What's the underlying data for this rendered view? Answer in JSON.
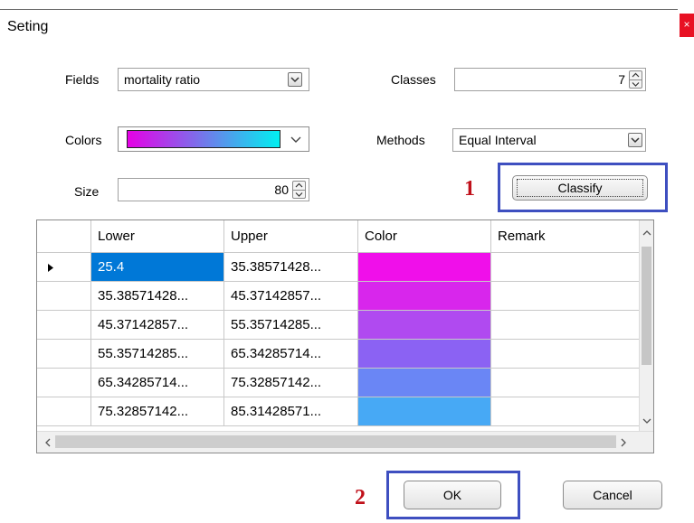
{
  "window": {
    "title": "Seting",
    "close_glyph": "×"
  },
  "form": {
    "fields_label": "Fields",
    "fields_value": "mortality ratio",
    "classes_label": "Classes",
    "classes_value": "7",
    "colors_label": "Colors",
    "color_ramp": [
      "#e600e6",
      "#00f0f0"
    ],
    "methods_label": "Methods",
    "methods_value": "Equal Interval",
    "size_label": "Size",
    "size_value": "80"
  },
  "classify_button": "Classify",
  "annotations": {
    "marker_1": "1",
    "marker_2": "2",
    "highlight_color": "#3e4fc0",
    "marker_color": "#c0101a"
  },
  "table": {
    "columns": [
      "Lower",
      "Upper",
      "Color",
      "Remark"
    ],
    "rows": [
      {
        "lower": "25.4",
        "upper": "35.38571428...",
        "color": "#f00fea",
        "remark": ""
      },
      {
        "lower": "35.38571428...",
        "upper": "45.37142857...",
        "color": "#d826ec",
        "remark": ""
      },
      {
        "lower": "45.37142857...",
        "upper": "55.35714285...",
        "color": "#b04af0",
        "remark": ""
      },
      {
        "lower": "55.35714285...",
        "upper": "65.34285714...",
        "color": "#8b62f3",
        "remark": ""
      },
      {
        "lower": "65.34285714...",
        "upper": "75.32857142...",
        "color": "#6a86f5",
        "remark": ""
      },
      {
        "lower": "75.32857142...",
        "upper": "85.31428571...",
        "color": "#47a9f5",
        "remark": ""
      }
    ],
    "selected_row": 0
  },
  "footer": {
    "ok_label": "OK",
    "cancel_label": "Cancel"
  }
}
